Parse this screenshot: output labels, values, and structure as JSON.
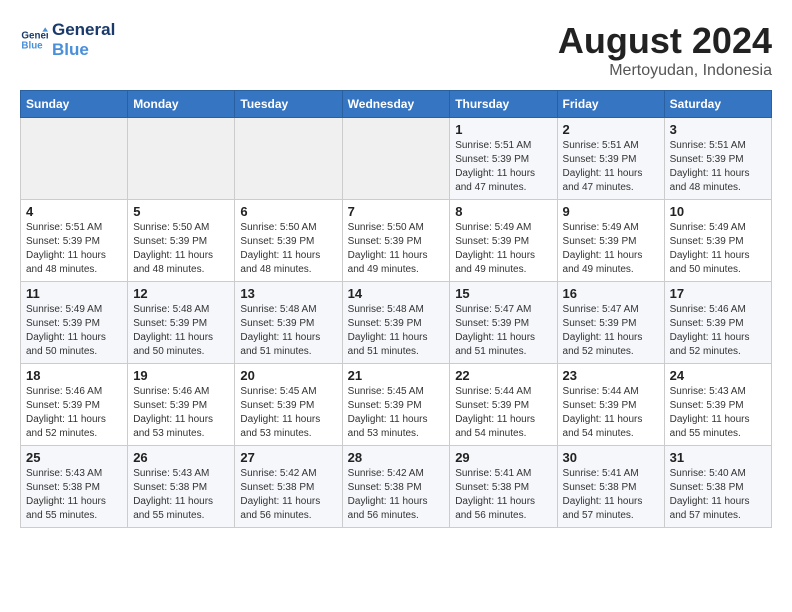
{
  "header": {
    "logo_line1": "General",
    "logo_line2": "Blue",
    "title": "August 2024",
    "subtitle": "Mertoyudan, Indonesia"
  },
  "weekdays": [
    "Sunday",
    "Monday",
    "Tuesday",
    "Wednesday",
    "Thursday",
    "Friday",
    "Saturday"
  ],
  "weeks": [
    [
      {
        "day": "",
        "info": ""
      },
      {
        "day": "",
        "info": ""
      },
      {
        "day": "",
        "info": ""
      },
      {
        "day": "",
        "info": ""
      },
      {
        "day": "1",
        "info": "Sunrise: 5:51 AM\nSunset: 5:39 PM\nDaylight: 11 hours and 47 minutes."
      },
      {
        "day": "2",
        "info": "Sunrise: 5:51 AM\nSunset: 5:39 PM\nDaylight: 11 hours and 47 minutes."
      },
      {
        "day": "3",
        "info": "Sunrise: 5:51 AM\nSunset: 5:39 PM\nDaylight: 11 hours and 48 minutes."
      }
    ],
    [
      {
        "day": "4",
        "info": "Sunrise: 5:51 AM\nSunset: 5:39 PM\nDaylight: 11 hours and 48 minutes."
      },
      {
        "day": "5",
        "info": "Sunrise: 5:50 AM\nSunset: 5:39 PM\nDaylight: 11 hours and 48 minutes."
      },
      {
        "day": "6",
        "info": "Sunrise: 5:50 AM\nSunset: 5:39 PM\nDaylight: 11 hours and 48 minutes."
      },
      {
        "day": "7",
        "info": "Sunrise: 5:50 AM\nSunset: 5:39 PM\nDaylight: 11 hours and 49 minutes."
      },
      {
        "day": "8",
        "info": "Sunrise: 5:49 AM\nSunset: 5:39 PM\nDaylight: 11 hours and 49 minutes."
      },
      {
        "day": "9",
        "info": "Sunrise: 5:49 AM\nSunset: 5:39 PM\nDaylight: 11 hours and 49 minutes."
      },
      {
        "day": "10",
        "info": "Sunrise: 5:49 AM\nSunset: 5:39 PM\nDaylight: 11 hours and 50 minutes."
      }
    ],
    [
      {
        "day": "11",
        "info": "Sunrise: 5:49 AM\nSunset: 5:39 PM\nDaylight: 11 hours and 50 minutes."
      },
      {
        "day": "12",
        "info": "Sunrise: 5:48 AM\nSunset: 5:39 PM\nDaylight: 11 hours and 50 minutes."
      },
      {
        "day": "13",
        "info": "Sunrise: 5:48 AM\nSunset: 5:39 PM\nDaylight: 11 hours and 51 minutes."
      },
      {
        "day": "14",
        "info": "Sunrise: 5:48 AM\nSunset: 5:39 PM\nDaylight: 11 hours and 51 minutes."
      },
      {
        "day": "15",
        "info": "Sunrise: 5:47 AM\nSunset: 5:39 PM\nDaylight: 11 hours and 51 minutes."
      },
      {
        "day": "16",
        "info": "Sunrise: 5:47 AM\nSunset: 5:39 PM\nDaylight: 11 hours and 52 minutes."
      },
      {
        "day": "17",
        "info": "Sunrise: 5:46 AM\nSunset: 5:39 PM\nDaylight: 11 hours and 52 minutes."
      }
    ],
    [
      {
        "day": "18",
        "info": "Sunrise: 5:46 AM\nSunset: 5:39 PM\nDaylight: 11 hours and 52 minutes."
      },
      {
        "day": "19",
        "info": "Sunrise: 5:46 AM\nSunset: 5:39 PM\nDaylight: 11 hours and 53 minutes."
      },
      {
        "day": "20",
        "info": "Sunrise: 5:45 AM\nSunset: 5:39 PM\nDaylight: 11 hours and 53 minutes."
      },
      {
        "day": "21",
        "info": "Sunrise: 5:45 AM\nSunset: 5:39 PM\nDaylight: 11 hours and 53 minutes."
      },
      {
        "day": "22",
        "info": "Sunrise: 5:44 AM\nSunset: 5:39 PM\nDaylight: 11 hours and 54 minutes."
      },
      {
        "day": "23",
        "info": "Sunrise: 5:44 AM\nSunset: 5:39 PM\nDaylight: 11 hours and 54 minutes."
      },
      {
        "day": "24",
        "info": "Sunrise: 5:43 AM\nSunset: 5:39 PM\nDaylight: 11 hours and 55 minutes."
      }
    ],
    [
      {
        "day": "25",
        "info": "Sunrise: 5:43 AM\nSunset: 5:38 PM\nDaylight: 11 hours and 55 minutes."
      },
      {
        "day": "26",
        "info": "Sunrise: 5:43 AM\nSunset: 5:38 PM\nDaylight: 11 hours and 55 minutes."
      },
      {
        "day": "27",
        "info": "Sunrise: 5:42 AM\nSunset: 5:38 PM\nDaylight: 11 hours and 56 minutes."
      },
      {
        "day": "28",
        "info": "Sunrise: 5:42 AM\nSunset: 5:38 PM\nDaylight: 11 hours and 56 minutes."
      },
      {
        "day": "29",
        "info": "Sunrise: 5:41 AM\nSunset: 5:38 PM\nDaylight: 11 hours and 56 minutes."
      },
      {
        "day": "30",
        "info": "Sunrise: 5:41 AM\nSunset: 5:38 PM\nDaylight: 11 hours and 57 minutes."
      },
      {
        "day": "31",
        "info": "Sunrise: 5:40 AM\nSunset: 5:38 PM\nDaylight: 11 hours and 57 minutes."
      }
    ]
  ]
}
